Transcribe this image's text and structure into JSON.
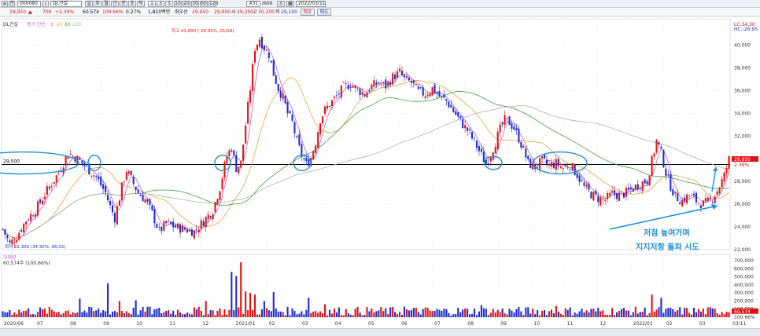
{
  "toolbar": {
    "period_label": "견",
    "code_value": "000080",
    "name_value": "DL건설",
    "period_buttons": [
      "일",
      "주",
      "월",
      "년",
      "분",
      "초",
      "틱"
    ],
    "minute_buttons": [
      "1",
      "3",
      "5",
      "10",
      "20",
      "30",
      "60",
      "120"
    ],
    "count_value": "431",
    "count_total": "/600",
    "date_value": "2022/03/11"
  },
  "quote": {
    "price": "29,950",
    "change": "700",
    "change_pct": "+2.39%",
    "volume": "60,574",
    "volume_ratio": "100.66%",
    "turnover": "0.27%",
    "amount": "1,810백만",
    "ask_label": "최우선",
    "ask_value": "29,950",
    "open_prefix": "29,900",
    "open_label": "시",
    "open_value": "29,350",
    "high_label": "고",
    "high_value": "30,200",
    "low_label": "저",
    "low_value": "29,100",
    "buy_button": "매수",
    "sell_button": "매도"
  },
  "colors": {
    "up": "#e01010",
    "down": "#1a2bd0",
    "ma5": "#c060d0",
    "ma20": "#f0a040",
    "ma60": "#40a040",
    "ma120": "#b0b0b0",
    "annotation": "#1e90d8",
    "hline": "#000000"
  },
  "chart_data": {
    "type": "candlestick",
    "title": "DL건설",
    "legend": [
      "종가 단순",
      "5",
      "20",
      "60",
      "120"
    ],
    "ylim": [
      22000,
      41500
    ],
    "y_ticks": [
      "40,000",
      "38,000",
      "36,000",
      "34,000",
      "32,000",
      "30,000",
      "28,000",
      "26,000",
      "24,000",
      "22,000"
    ],
    "y_tick_values": [
      40000,
      38000,
      36000,
      34000,
      32000,
      30000,
      28000,
      26000,
      24000,
      22000
    ],
    "right_labels": [
      "LC:34.30",
      "HC:-26.95"
    ],
    "current_price_label": "29,950",
    "current_pct_label": "2.39%",
    "hline_label": "29,500",
    "hline_value": 29500,
    "high_annotation": "최고 41,000 (-26.95%, 01/19)",
    "low_annotation": "최저 22,300 (34.30%, 06/15)",
    "x_labels": [
      "2020/06",
      "07",
      "08",
      "09",
      "10",
      "11",
      "12",
      "2021/01",
      "02",
      "03",
      "04",
      "05",
      "06",
      "07",
      "08",
      "09",
      "10",
      "11",
      "12",
      "2022/01",
      "02",
      "03",
      "03/11"
    ],
    "close_path": [
      [
        0,
        23800
      ],
      [
        3,
        22500
      ],
      [
        6,
        23200
      ],
      [
        10,
        24600
      ],
      [
        14,
        25500
      ],
      [
        19,
        27200
      ],
      [
        24,
        28800
      ],
      [
        28,
        30500
      ],
      [
        32,
        30000
      ],
      [
        36,
        29200
      ],
      [
        40,
        28400
      ],
      [
        44,
        27000
      ],
      [
        46,
        25800
      ],
      [
        48,
        24800
      ],
      [
        51,
        27500
      ],
      [
        53,
        29000
      ],
      [
        55,
        28200
      ],
      [
        58,
        27000
      ],
      [
        61,
        26400
      ],
      [
        64,
        25200
      ],
      [
        67,
        23600
      ],
      [
        70,
        24300
      ],
      [
        74,
        24000
      ],
      [
        78,
        23800
      ],
      [
        82,
        23600
      ],
      [
        86,
        24500
      ],
      [
        90,
        25500
      ],
      [
        93,
        27500
      ],
      [
        96,
        30300
      ],
      [
        98,
        31000
      ],
      [
        100,
        29200
      ],
      [
        102,
        29600
      ],
      [
        104,
        33000
      ],
      [
        106,
        36200
      ],
      [
        108,
        39800
      ],
      [
        110,
        40600
      ],
      [
        112,
        39800
      ],
      [
        114,
        39200
      ],
      [
        116,
        37500
      ],
      [
        118,
        36200
      ],
      [
        120,
        35400
      ],
      [
        122,
        34000
      ],
      [
        124,
        33200
      ],
      [
        126,
        31500
      ],
      [
        128,
        30300
      ],
      [
        130,
        29500
      ],
      [
        132,
        30100
      ],
      [
        134,
        31500
      ],
      [
        136,
        33500
      ],
      [
        138,
        34300
      ],
      [
        140,
        34800
      ],
      [
        143,
        35500
      ],
      [
        146,
        36300
      ],
      [
        149,
        36600
      ],
      [
        152,
        36100
      ],
      [
        155,
        35700
      ],
      [
        158,
        36400
      ],
      [
        161,
        36700
      ],
      [
        164,
        36400
      ],
      [
        167,
        37200
      ],
      [
        170,
        37600
      ],
      [
        172,
        37000
      ],
      [
        175,
        36700
      ],
      [
        178,
        35900
      ],
      [
        181,
        35700
      ],
      [
        184,
        36200
      ],
      [
        187,
        35500
      ],
      [
        190,
        35100
      ],
      [
        193,
        34200
      ],
      [
        196,
        33300
      ],
      [
        199,
        32500
      ],
      [
        202,
        31500
      ],
      [
        205,
        30300
      ],
      [
        207,
        29600
      ],
      [
        209,
        30400
      ],
      [
        211,
        31500
      ],
      [
        213,
        32600
      ],
      [
        215,
        33400
      ],
      [
        217,
        33200
      ],
      [
        219,
        32700
      ],
      [
        221,
        31800
      ],
      [
        223,
        30800
      ],
      [
        225,
        29600
      ],
      [
        228,
        29300
      ],
      [
        231,
        29800
      ],
      [
        234,
        29400
      ],
      [
        237,
        29600
      ],
      [
        240,
        29200
      ],
      [
        243,
        29500
      ],
      [
        246,
        28600
      ],
      [
        249,
        27500
      ],
      [
        252,
        26900
      ],
      [
        255,
        26500
      ],
      [
        258,
        26400
      ],
      [
        261,
        26900
      ],
      [
        264,
        26800
      ],
      [
        267,
        27000
      ],
      [
        270,
        27400
      ],
      [
        273,
        27800
      ],
      [
        276,
        28100
      ],
      [
        278,
        29800
      ],
      [
        280,
        31600
      ],
      [
        282,
        30500
      ],
      [
        284,
        28800
      ],
      [
        286,
        27600
      ],
      [
        288,
        26700
      ],
      [
        291,
        26300
      ],
      [
        294,
        26800
      ],
      [
        297,
        26300
      ],
      [
        300,
        26000
      ],
      [
        303,
        26300
      ],
      [
        306,
        27200
      ],
      [
        309,
        28500
      ],
      [
        311,
        29950
      ]
    ],
    "volume_ylim": [
      0,
      720000
    ],
    "volume_y_ticks": [
      "700,000",
      "600,000",
      "500,000",
      "400,000",
      "300,000",
      "200,000",
      "100,000"
    ],
    "volume_y_tick_values": [
      700000,
      600000,
      500000,
      400000,
      300000,
      200000,
      100000
    ],
    "volume_title": "거래량",
    "volume_value_label": "60,574주 (100.66%)",
    "volume_current_label": "60,574",
    "volume_current_pct": "100.66%",
    "volume_spikes": [
      [
        33,
        230000
      ],
      [
        45,
        420000
      ],
      [
        50,
        200000
      ],
      [
        57,
        210000
      ],
      [
        63,
        130000
      ],
      [
        87,
        200000
      ],
      [
        98,
        560000
      ],
      [
        100,
        510000
      ],
      [
        102,
        680000
      ],
      [
        104,
        320000
      ],
      [
        106,
        300000
      ],
      [
        108,
        280000
      ],
      [
        112,
        200000
      ],
      [
        116,
        310000
      ],
      [
        131,
        240000
      ],
      [
        138,
        160000
      ],
      [
        172,
        130000
      ],
      [
        205,
        150000
      ],
      [
        237,
        140000
      ],
      [
        278,
        280000
      ],
      [
        282,
        240000
      ],
      [
        311,
        60574
      ]
    ],
    "annotation_text": [
      "저점 높여가며",
      "지지저항 돌파 시도"
    ]
  }
}
